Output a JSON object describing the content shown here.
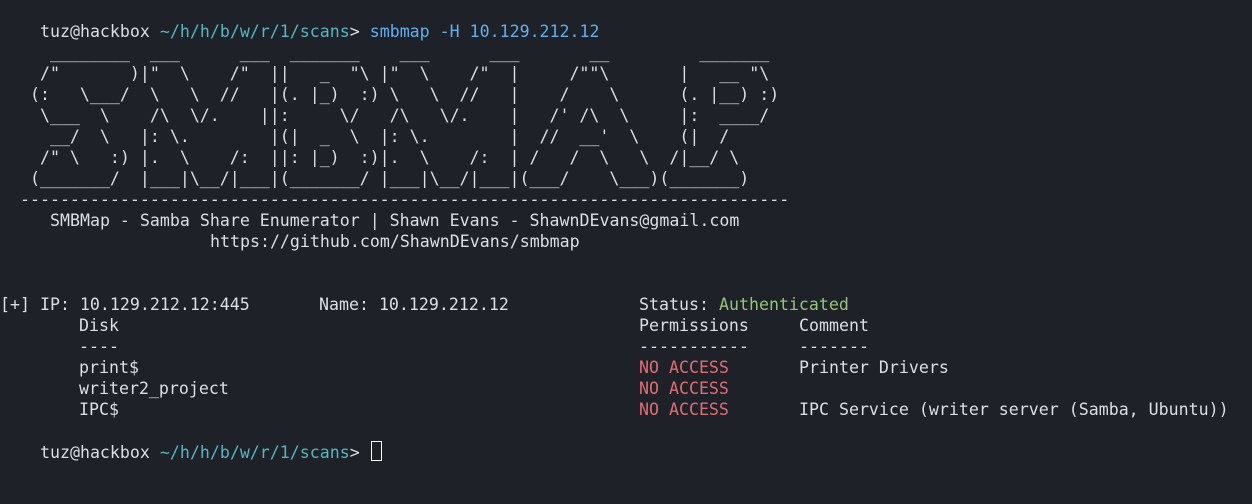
{
  "prompt": {
    "user": "tuz",
    "at": "@",
    "host": "hackbox",
    "path": "~/h/h/b/w/r/1/scans",
    "symbol": ">"
  },
  "command": "smbmap -H 10.129.212.12",
  "banner": {
    "art": [
      "     ________  ___      ___  _______    ___      ___       __         _______",
      "    /\"       )|\"  \\    /\"  ||   _  \"\\ |\"  \\    /\"  |     /\"\"\\       |   __ \"\\",
      "   (:   \\___/  \\   \\  //   |(. |_)  :) \\   \\  //   |    /    \\      (. |__) :)",
      "    \\___  \\    /\\  \\/.    ||:     \\/   /\\   \\/.    |   /' /\\  \\     |:  ____/",
      "     __/  \\   |: \\.        |(|  _  \\  |: \\.        |  //  __'  \\    (|  /",
      "    /\" \\   :) |.  \\    /:  ||: |_)  :)|.  \\    /:  | /   /  \\   \\  /|__/ \\",
      "   (_______/  |___|\\__/|___|(_______/ |___|\\__/|___|(___/    \\___)(_______)",
      "  -----------------------------------------------------------------------------"
    ],
    "tagline": "SMBMap - Samba Share Enumerator | Shawn Evans - ShawnDEvans@gmail.com",
    "url": "https://github.com/ShawnDEvans/smbmap"
  },
  "result": {
    "ip_label": "[+] IP: 10.129.212.12:445",
    "name_label": "Name: 10.129.212.12",
    "status_label": "Status:",
    "status_value": "Authenticated",
    "headers": {
      "disk": "Disk",
      "permissions": "Permissions",
      "comment": "Comment"
    },
    "dividers": {
      "disk": "----",
      "permissions": "-----------",
      "comment": "-------"
    },
    "shares": [
      {
        "disk": "print$",
        "permissions": "NO ACCESS",
        "comment": "Printer Drivers"
      },
      {
        "disk": "writer2_project",
        "permissions": "NO ACCESS",
        "comment": ""
      },
      {
        "disk": "IPC$",
        "permissions": "NO ACCESS",
        "comment": "IPC Service (writer server (Samba, Ubuntu))"
      }
    ]
  },
  "colors": {
    "background": "#1e2127",
    "text": "#dcdfe4",
    "path": "#56b6c2",
    "command": "#61afef",
    "status_ok": "#98c379",
    "no_access": "#e06c75"
  }
}
